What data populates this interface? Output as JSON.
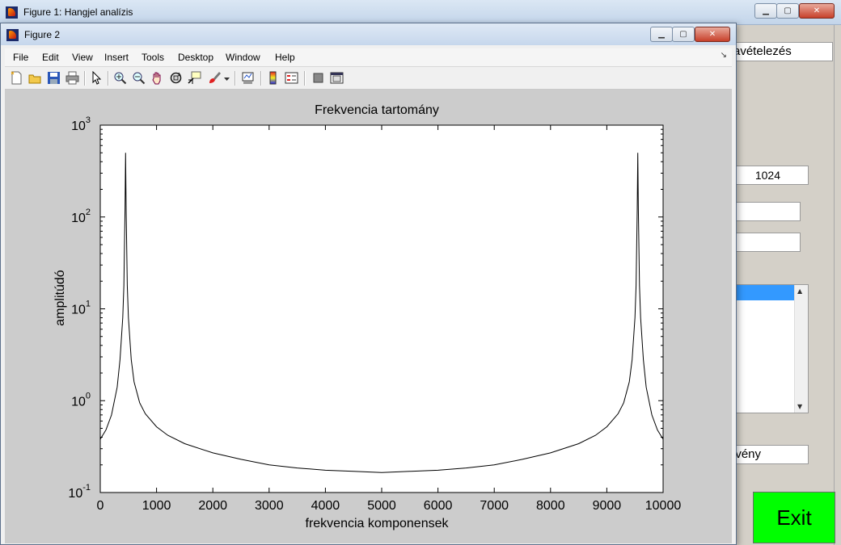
{
  "figure1": {
    "title": "Figure 1: Hangjel analízis",
    "field_top_text": "avételezés",
    "field_samples": "1024",
    "field_edit1": "",
    "field_edit2": "",
    "field_function_text": "gvény",
    "exit_label": "Exit",
    "exit_color": "#00ff00"
  },
  "figure2": {
    "title": "Figure 2",
    "menu": [
      "File",
      "Edit",
      "View",
      "Insert",
      "Tools",
      "Desktop",
      "Window",
      "Help"
    ],
    "toolbar_icons": [
      "new-figure-icon",
      "open-file-icon",
      "save-icon",
      "print-icon",
      "edit-plot-arrow-icon",
      "zoom-in-icon",
      "zoom-out-icon",
      "pan-hand-icon",
      "rotate-3d-icon",
      "data-cursor-icon",
      "brush-icon",
      "brush-dropdown-icon",
      "link-plot-icon",
      "colorbar-icon",
      "legend-icon",
      "hide-plot-tools-icon",
      "show-plot-tools-icon"
    ]
  },
  "chart_data": {
    "type": "line",
    "title": "Frekvencia tartomány",
    "xlabel": "frekvencia komponensek",
    "ylabel": "amplitúdó",
    "xlim": [
      0,
      10000
    ],
    "ylim": [
      0.1,
      1000
    ],
    "yscale": "log",
    "grid": false,
    "line_color": "#000000",
    "x_ticks": [
      "0",
      "1000",
      "2000",
      "3000",
      "4000",
      "5000",
      "6000",
      "7000",
      "8000",
      "9000",
      "10000"
    ],
    "y_ticks": [
      {
        "base": "10",
        "exp": "-1",
        "value": 0.1
      },
      {
        "base": "10",
        "exp": "0",
        "value": 1
      },
      {
        "base": "10",
        "exp": "1",
        "value": 10
      },
      {
        "base": "10",
        "exp": "2",
        "value": 100
      },
      {
        "base": "10",
        "exp": "3",
        "value": 1000
      }
    ],
    "series": [
      {
        "x": [
          0,
          100,
          200,
          300,
          350,
          400,
          420,
          440,
          450,
          460,
          480,
          500,
          550,
          600,
          700,
          800,
          1000,
          1200,
          1500,
          2000,
          2500,
          3000,
          3500,
          4000,
          4500,
          5000,
          5500,
          6000,
          6500,
          7000,
          7500,
          8000,
          8500,
          8800,
          9000,
          9200,
          9300,
          9400,
          9450,
          9500,
          9520,
          9540,
          9550,
          9560,
          9580,
          9600,
          9650,
          9700,
          9800,
          9900,
          10000
        ],
        "y": [
          0.38,
          0.48,
          0.7,
          1.4,
          2.8,
          8,
          18,
          120,
          500,
          120,
          18,
          8,
          2.8,
          1.6,
          0.95,
          0.72,
          0.52,
          0.42,
          0.34,
          0.27,
          0.23,
          0.2,
          0.185,
          0.175,
          0.17,
          0.165,
          0.17,
          0.175,
          0.185,
          0.2,
          0.23,
          0.27,
          0.34,
          0.42,
          0.52,
          0.72,
          0.95,
          1.6,
          2.8,
          8,
          18,
          120,
          500,
          120,
          18,
          8,
          2.8,
          1.4,
          0.7,
          0.48,
          0.38
        ]
      }
    ]
  }
}
